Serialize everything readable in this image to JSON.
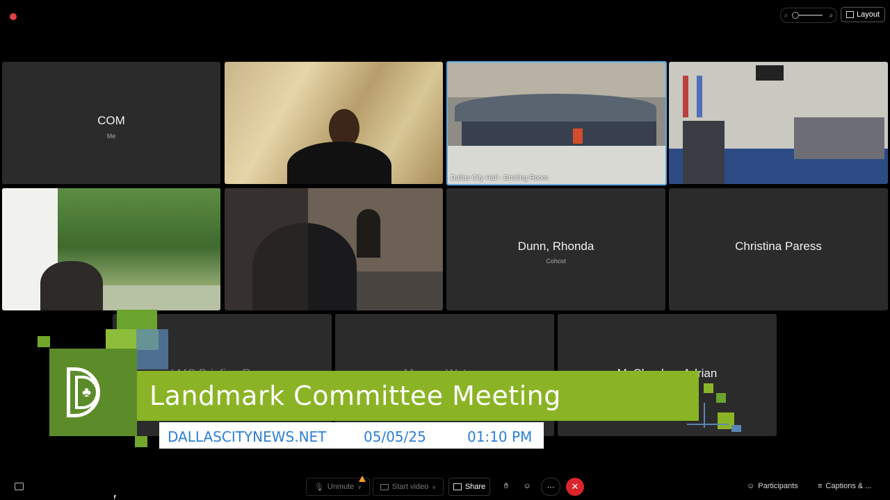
{
  "top": {
    "layout_label": "Layout"
  },
  "tiles": {
    "com_name": "COM",
    "com_sub": "Me",
    "city_hall_label": "Dallas City Hall - Briefing Room",
    "dunn_name": "Dunn, Rhonda",
    "dunn_sub": "Cohost",
    "christina_name": "Christina Paress",
    "lmc_name": "LMC Briefing Room",
    "marcus_name": "Marcus Watson",
    "mcclendon_name": "McClendon, Adrian"
  },
  "banner": {
    "title": "Landmark Committee Meeting",
    "website": "DALLASCITYNEWS.NET",
    "date": "05/05/25",
    "time": "01:10 PM"
  },
  "toolbar": {
    "unmute": "Unmute",
    "start_video": "Start video",
    "share": "Share",
    "participants": "Participants",
    "captions": "Captions & ..."
  },
  "colors": {
    "banner_green": "#8ab425",
    "logo_green": "#5c8c2a",
    "link_blue": "#2c7fd8",
    "end_red": "#d9252b",
    "active_border": "#5aa9e6"
  }
}
